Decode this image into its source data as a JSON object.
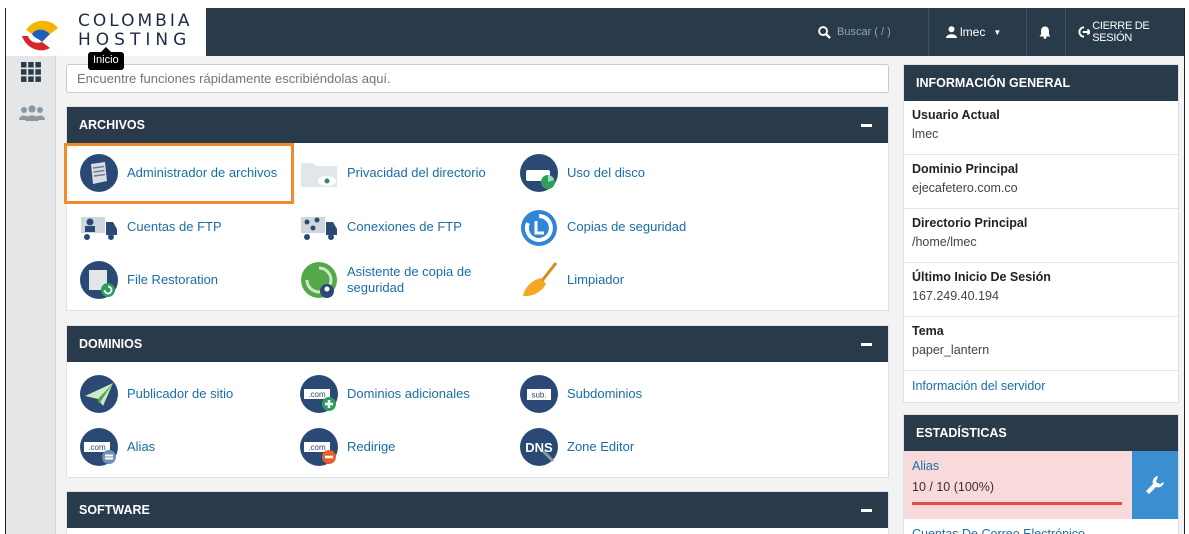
{
  "topbar": {
    "logo_line1": "COLOMBIA",
    "logo_line2": "HOSTING",
    "search_label": "Buscar ( / )",
    "user_label": "lmec",
    "logout_label": "CIERRE DE SESIÓN",
    "tooltip": "Inicio"
  },
  "search": {
    "placeholder": "Encuentre funciones rápidamente escribiéndolas aquí."
  },
  "sections": {
    "archivos": {
      "title": "ARCHIVOS",
      "items": [
        {
          "label": "Administrador de archivos"
        },
        {
          "label": "Privacidad del directorio"
        },
        {
          "label": "Uso del disco"
        },
        {
          "label": "Cuentas de FTP"
        },
        {
          "label": "Conexiones de FTP"
        },
        {
          "label": "Copias de seguridad"
        },
        {
          "label": "File Restoration"
        },
        {
          "label": "Asistente de copia de seguridad"
        },
        {
          "label": "Limpiador"
        }
      ]
    },
    "dominios": {
      "title": "DOMINIOS",
      "items": [
        {
          "label": "Publicador de sitio"
        },
        {
          "label": "Dominios adicionales"
        },
        {
          "label": "Subdominios"
        },
        {
          "label": "Alias"
        },
        {
          "label": "Redirige"
        },
        {
          "label": "Zone Editor"
        }
      ]
    },
    "software": {
      "title": "SOFTWARE"
    }
  },
  "icon_text": {
    "com": ".com",
    "sub": "sub.",
    "dns": "DNS"
  },
  "general_info": {
    "title": "INFORMACIÓN GENERAL",
    "rows": [
      {
        "key": "Usuario Actual",
        "value": "lmec"
      },
      {
        "key": "Dominio Principal",
        "value": "ejecafetero.com.co"
      },
      {
        "key": "Directorio Principal",
        "value": "/home/lmec"
      },
      {
        "key": "Último Inicio De Sesión",
        "value": "167.249.40.194"
      },
      {
        "key": "Tema",
        "value": "paper_lantern"
      }
    ],
    "server_info_link": "Información del servidor"
  },
  "stats": {
    "title": "ESTADÍSTICAS",
    "alias_label": "Alias",
    "alias_value": "10 / 10  (100%)",
    "alias_usage": 1.0,
    "next_label": "Cuentas De Correo Electrónico"
  },
  "colors": {
    "header": "#293a4a",
    "link": "#1a6ea8",
    "highlight": "#f08a2e",
    "stat_alert": "#f9dada",
    "stat_bar": "#e24b4b"
  }
}
